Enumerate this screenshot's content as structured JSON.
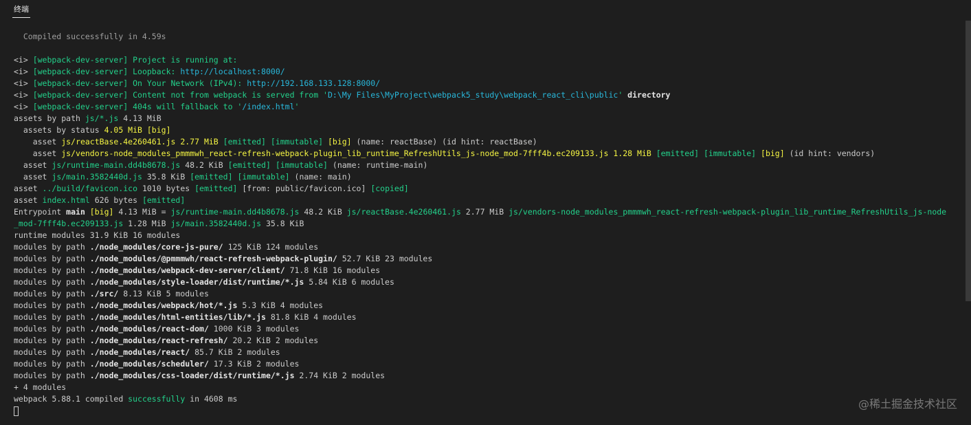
{
  "tab": {
    "label": "终端"
  },
  "watermark": "@稀土掘金技术社区",
  "colors": {
    "background": "#1e1e1e",
    "text": "#cccccc",
    "green": "#23d18b",
    "cyan": "#29b8db",
    "yellow": "#f5f543"
  },
  "lines": [
    [
      {
        "t": "  Compiled successfully in 4.59s",
        "c": "gray"
      }
    ],
    [],
    [
      {
        "t": "<i> ",
        "c": "white"
      },
      {
        "t": "[webpack-dev-server] Project is running at:",
        "c": "green"
      }
    ],
    [
      {
        "t": "<i> ",
        "c": "white"
      },
      {
        "t": "[webpack-dev-server] Loopback: ",
        "c": "green"
      },
      {
        "t": "http://localhost:8000/",
        "c": "cyan"
      }
    ],
    [
      {
        "t": "<i> ",
        "c": "white"
      },
      {
        "t": "[webpack-dev-server] On Your Network (IPv4): ",
        "c": "green"
      },
      {
        "t": "http://192.168.133.128:8000/",
        "c": "cyan"
      }
    ],
    [
      {
        "t": "<i> ",
        "c": "white"
      },
      {
        "t": "[webpack-dev-server] Content not from webpack is served from '",
        "c": "green"
      },
      {
        "t": "D:\\My Files\\MyProject\\webpack5_study\\webpack_react_cli\\public",
        "c": "cyan"
      },
      {
        "t": "' ",
        "c": "green"
      },
      {
        "t": "directory",
        "c": "boldwhite"
      }
    ],
    [
      {
        "t": "<i> ",
        "c": "white"
      },
      {
        "t": "[webpack-dev-server] 404s will fallback to '",
        "c": "green"
      },
      {
        "t": "/index.html",
        "c": "cyan"
      },
      {
        "t": "'",
        "c": "green"
      }
    ],
    [
      {
        "t": "assets by path ",
        "c": "white"
      },
      {
        "t": "js/*.js",
        "c": "green"
      },
      {
        "t": " 4.13 MiB",
        "c": "white"
      }
    ],
    [
      {
        "t": "  assets by status ",
        "c": "white"
      },
      {
        "t": "4.05 MiB [big]",
        "c": "yellow"
      }
    ],
    [
      {
        "t": "    asset ",
        "c": "white"
      },
      {
        "t": "js/reactBase.4e260461.js 2.77 MiB",
        "c": "yellow"
      },
      {
        "t": " [emitted] [immutable] ",
        "c": "green"
      },
      {
        "t": "[big]",
        "c": "yellow"
      },
      {
        "t": " (name: reactBase) (id hint: reactBase)",
        "c": "white"
      }
    ],
    [
      {
        "t": "    asset ",
        "c": "white"
      },
      {
        "t": "js/vendors-node_modules_pmmmwh_react-refresh-webpack-plugin_lib_runtime_RefreshUtils_js-node_mod-7fff4b.ec209133.js 1.28 MiB",
        "c": "yellow"
      },
      {
        "t": " [emitted] [immutable] ",
        "c": "green"
      },
      {
        "t": "[big]",
        "c": "yellow"
      },
      {
        "t": " (id hint: vendors)",
        "c": "white"
      }
    ],
    [
      {
        "t": "  asset ",
        "c": "white"
      },
      {
        "t": "js/runtime-main.dd4b8678.js",
        "c": "green"
      },
      {
        "t": " 48.2 KiB ",
        "c": "white"
      },
      {
        "t": "[emitted] [immutable]",
        "c": "green"
      },
      {
        "t": " (name: runtime-main)",
        "c": "white"
      }
    ],
    [
      {
        "t": "  asset ",
        "c": "white"
      },
      {
        "t": "js/main.3582440d.js",
        "c": "green"
      },
      {
        "t": " 35.8 KiB ",
        "c": "white"
      },
      {
        "t": "[emitted] [immutable]",
        "c": "green"
      },
      {
        "t": " (name: main)",
        "c": "white"
      }
    ],
    [
      {
        "t": "asset ",
        "c": "white"
      },
      {
        "t": "../build/favicon.ico",
        "c": "green"
      },
      {
        "t": " 1010 bytes ",
        "c": "white"
      },
      {
        "t": "[emitted]",
        "c": "green"
      },
      {
        "t": " [from: public/favicon.ico] ",
        "c": "white"
      },
      {
        "t": "[copied]",
        "c": "green"
      }
    ],
    [
      {
        "t": "asset ",
        "c": "white"
      },
      {
        "t": "index.html",
        "c": "green"
      },
      {
        "t": " 626 bytes ",
        "c": "white"
      },
      {
        "t": "[emitted]",
        "c": "green"
      }
    ],
    [
      {
        "t": "Entrypoint ",
        "c": "white"
      },
      {
        "t": "main",
        "c": "boldwhite"
      },
      {
        "t": " [big]",
        "c": "yellow"
      },
      {
        "t": " 4.13 MiB = ",
        "c": "white"
      },
      {
        "t": "js/runtime-main.dd4b8678.js",
        "c": "green"
      },
      {
        "t": " 48.2 KiB ",
        "c": "white"
      },
      {
        "t": "js/reactBase.4e260461.js",
        "c": "green"
      },
      {
        "t": " 2.77 MiB ",
        "c": "white"
      },
      {
        "t": "js/vendors-node_modules_pmmmwh_react-refresh-webpack-plugin_lib_runtime_RefreshUtils_js-node",
        "c": "green"
      }
    ],
    [
      {
        "t": "_mod-7fff4b.ec209133.js",
        "c": "green"
      },
      {
        "t": " 1.28 MiB ",
        "c": "white"
      },
      {
        "t": "js/main.3582440d.js",
        "c": "green"
      },
      {
        "t": " 35.8 KiB",
        "c": "white"
      }
    ],
    [
      {
        "t": "runtime modules 31.9 KiB 16 modules",
        "c": "white"
      }
    ],
    [
      {
        "t": "modules by path ",
        "c": "white"
      },
      {
        "t": "./node_modules/core-js-pure/",
        "c": "boldwhite"
      },
      {
        "t": " 125 KiB 124 modules",
        "c": "white"
      }
    ],
    [
      {
        "t": "modules by path ",
        "c": "white"
      },
      {
        "t": "./node_modules/@pmmmwh/react-refresh-webpack-plugin/",
        "c": "boldwhite"
      },
      {
        "t": " 52.7 KiB 23 modules",
        "c": "white"
      }
    ],
    [
      {
        "t": "modules by path ",
        "c": "white"
      },
      {
        "t": "./node_modules/webpack-dev-server/client/",
        "c": "boldwhite"
      },
      {
        "t": " 71.8 KiB 16 modules",
        "c": "white"
      }
    ],
    [
      {
        "t": "modules by path ",
        "c": "white"
      },
      {
        "t": "./node_modules/style-loader/dist/runtime/*.js",
        "c": "boldwhite"
      },
      {
        "t": " 5.84 KiB 6 modules",
        "c": "white"
      }
    ],
    [
      {
        "t": "modules by path ",
        "c": "white"
      },
      {
        "t": "./src/",
        "c": "boldwhite"
      },
      {
        "t": " 8.13 KiB 5 modules",
        "c": "white"
      }
    ],
    [
      {
        "t": "modules by path ",
        "c": "white"
      },
      {
        "t": "./node_modules/webpack/hot/*.js",
        "c": "boldwhite"
      },
      {
        "t": " 5.3 KiB 4 modules",
        "c": "white"
      }
    ],
    [
      {
        "t": "modules by path ",
        "c": "white"
      },
      {
        "t": "./node_modules/html-entities/lib/*.js",
        "c": "boldwhite"
      },
      {
        "t": " 81.8 KiB 4 modules",
        "c": "white"
      }
    ],
    [
      {
        "t": "modules by path ",
        "c": "white"
      },
      {
        "t": "./node_modules/react-dom/",
        "c": "boldwhite"
      },
      {
        "t": " 1000 KiB 3 modules",
        "c": "white"
      }
    ],
    [
      {
        "t": "modules by path ",
        "c": "white"
      },
      {
        "t": "./node_modules/react-refresh/",
        "c": "boldwhite"
      },
      {
        "t": " 20.2 KiB 2 modules",
        "c": "white"
      }
    ],
    [
      {
        "t": "modules by path ",
        "c": "white"
      },
      {
        "t": "./node_modules/react/",
        "c": "boldwhite"
      },
      {
        "t": " 85.7 KiB 2 modules",
        "c": "white"
      }
    ],
    [
      {
        "t": "modules by path ",
        "c": "white"
      },
      {
        "t": "./node_modules/scheduler/",
        "c": "boldwhite"
      },
      {
        "t": " 17.3 KiB 2 modules",
        "c": "white"
      }
    ],
    [
      {
        "t": "modules by path ",
        "c": "white"
      },
      {
        "t": "./node_modules/css-loader/dist/runtime/*.js",
        "c": "boldwhite"
      },
      {
        "t": " 2.74 KiB 2 modules",
        "c": "white"
      }
    ],
    [
      {
        "t": "+ 4 modules",
        "c": "white"
      }
    ],
    [
      {
        "t": "webpack 5.88.1 compiled ",
        "c": "white"
      },
      {
        "t": "successfully",
        "c": "green"
      },
      {
        "t": " in 4608 ms",
        "c": "white"
      }
    ]
  ]
}
